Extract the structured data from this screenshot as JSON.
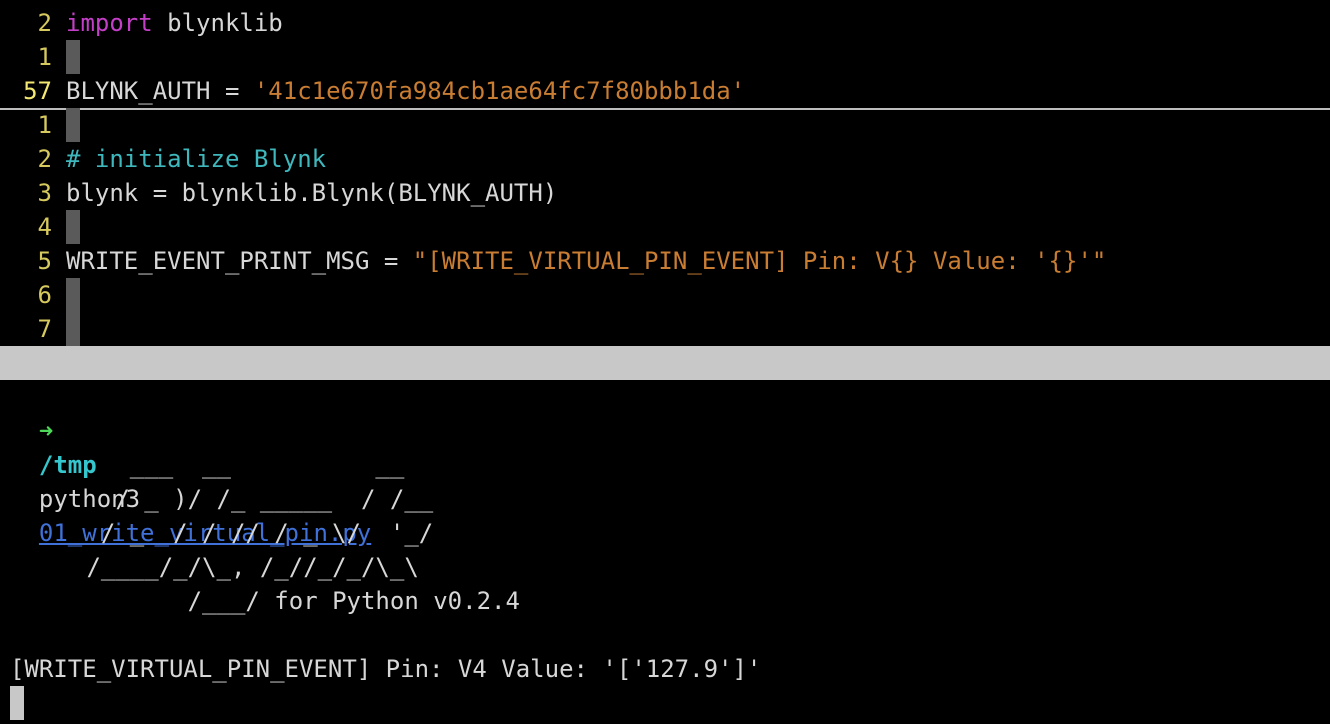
{
  "editor": {
    "lines": [
      {
        "num": "2",
        "parts": [
          {
            "t": "import",
            "c": "kw"
          },
          {
            "t": " blynklib",
            "c": "plain"
          }
        ]
      },
      {
        "num": "1",
        "parts": []
      },
      {
        "num": "57",
        "parts": [
          {
            "t": "BLYNK_AUTH = ",
            "c": "plain"
          },
          {
            "t": "'41c1e670fa984cb1ae64fc7f80bbb1da'",
            "c": "str"
          }
        ],
        "current": true
      },
      {
        "num": "1",
        "parts": []
      },
      {
        "num": "2",
        "parts": [
          {
            "t": "# initialize Blynk",
            "c": "cmt"
          }
        ]
      },
      {
        "num": "3",
        "parts": [
          {
            "t": "blynk = blynklib.Blynk(BLYNK_AUTH)",
            "c": "plain"
          }
        ]
      },
      {
        "num": "4",
        "parts": []
      },
      {
        "num": "5",
        "parts": [
          {
            "t": "WRITE_EVENT_PRINT_MSG = ",
            "c": "plain"
          },
          {
            "t": "\"[WRITE_VIRTUAL_PIN_EVENT] Pin: V{} Value: '{}'\"",
            "c": "str"
          }
        ]
      },
      {
        "num": "6",
        "parts": []
      },
      {
        "num": "7",
        "parts": []
      }
    ],
    "status_filename": "01_write_virtual_pin.py"
  },
  "terminal": {
    "prompt_arrow": "➜",
    "prompt_dir": "/tmp",
    "command": "python3",
    "command_arg": "01_write_virtual_pin.py",
    "banner": [
      "    ___  __          __",
      "   / _ )/ /_ _____  / /__",
      "  / _  / / // / _ \\/  '_/",
      " /____/_/\\_, /_//_/_/\\_\\",
      "        /___/ for Python v0.2.4"
    ],
    "output": "[WRITE_VIRTUAL_PIN_EVENT] Pin: V4 Value: '['127.9']'"
  }
}
